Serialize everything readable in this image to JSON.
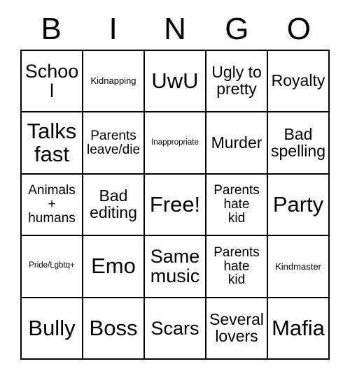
{
  "card": {
    "header": {
      "letters": [
        "B",
        "I",
        "N",
        "G",
        "O"
      ]
    },
    "colors": {
      "grid_line": "#000000",
      "text": "#000000",
      "background": "#ffffff"
    },
    "rows": [
      [
        {
          "text": "School",
          "size": "lg"
        },
        {
          "text": "Kidnapping",
          "size": "xs"
        },
        {
          "text": "UwU",
          "size": "xl"
        },
        {
          "text": "Ugly to\npretty",
          "size": "md"
        },
        {
          "text": "Royalty",
          "size": "md"
        }
      ],
      [
        {
          "text": "Talks\nfast",
          "size": "xl"
        },
        {
          "text": "Parents\nleave/die",
          "size": "sm"
        },
        {
          "text": "Inappropriate",
          "size": "xxs"
        },
        {
          "text": "Murder",
          "size": "md"
        },
        {
          "text": "Bad\nspelling",
          "size": "md"
        }
      ],
      [
        {
          "text": "Animals\n+\nhumans",
          "size": "sm"
        },
        {
          "text": "Bad\nediting",
          "size": "md"
        },
        {
          "text": "Free!",
          "size": "xl"
        },
        {
          "text": "Parents\nhate\nkid",
          "size": "sm"
        },
        {
          "text": "Party",
          "size": "xl"
        }
      ],
      [
        {
          "text": "Pride/Lgbtq+",
          "size": "xxs"
        },
        {
          "text": "Emo",
          "size": "xl"
        },
        {
          "text": "Same\nmusic",
          "size": "lg"
        },
        {
          "text": "Parents\nhate\nkid",
          "size": "sm"
        },
        {
          "text": "Kindmaster",
          "size": "xs"
        }
      ],
      [
        {
          "text": "Bully",
          "size": "xl"
        },
        {
          "text": "Boss",
          "size": "xl"
        },
        {
          "text": "Scars",
          "size": "lg"
        },
        {
          "text": "Several\nlovers",
          "size": "md"
        },
        {
          "text": "Mafia",
          "size": "xl"
        }
      ]
    ]
  }
}
